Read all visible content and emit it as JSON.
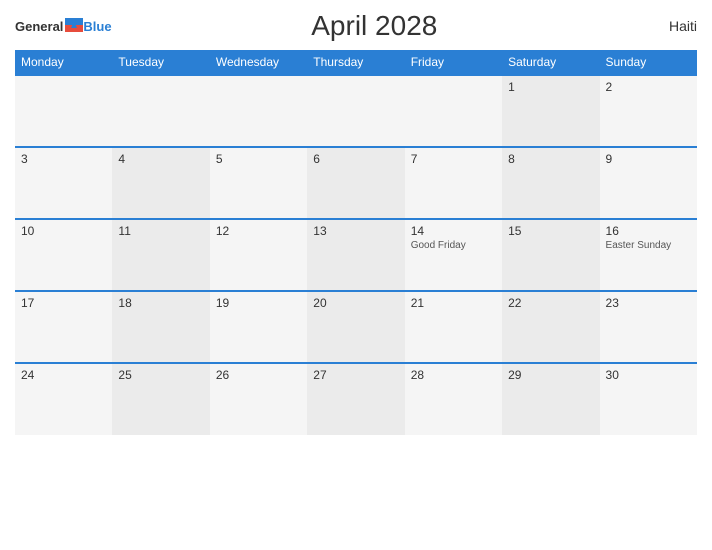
{
  "header": {
    "title": "April 2028",
    "country": "Haiti",
    "logo_general": "General",
    "logo_blue": "Blue"
  },
  "weekdays": [
    "Monday",
    "Tuesday",
    "Wednesday",
    "Thursday",
    "Friday",
    "Saturday",
    "Sunday"
  ],
  "weeks": [
    [
      {
        "day": "",
        "holiday": ""
      },
      {
        "day": "",
        "holiday": ""
      },
      {
        "day": "",
        "holiday": ""
      },
      {
        "day": "",
        "holiday": ""
      },
      {
        "day": "",
        "holiday": ""
      },
      {
        "day": "1",
        "holiday": ""
      },
      {
        "day": "2",
        "holiday": ""
      }
    ],
    [
      {
        "day": "3",
        "holiday": ""
      },
      {
        "day": "4",
        "holiday": ""
      },
      {
        "day": "5",
        "holiday": ""
      },
      {
        "day": "6",
        "holiday": ""
      },
      {
        "day": "7",
        "holiday": ""
      },
      {
        "day": "8",
        "holiday": ""
      },
      {
        "day": "9",
        "holiday": ""
      }
    ],
    [
      {
        "day": "10",
        "holiday": ""
      },
      {
        "day": "11",
        "holiday": ""
      },
      {
        "day": "12",
        "holiday": ""
      },
      {
        "day": "13",
        "holiday": ""
      },
      {
        "day": "14",
        "holiday": "Good Friday"
      },
      {
        "day": "15",
        "holiday": ""
      },
      {
        "day": "16",
        "holiday": "Easter Sunday"
      }
    ],
    [
      {
        "day": "17",
        "holiday": ""
      },
      {
        "day": "18",
        "holiday": ""
      },
      {
        "day": "19",
        "holiday": ""
      },
      {
        "day": "20",
        "holiday": ""
      },
      {
        "day": "21",
        "holiday": ""
      },
      {
        "day": "22",
        "holiday": ""
      },
      {
        "day": "23",
        "holiday": ""
      }
    ],
    [
      {
        "day": "24",
        "holiday": ""
      },
      {
        "day": "25",
        "holiday": ""
      },
      {
        "day": "26",
        "holiday": ""
      },
      {
        "day": "27",
        "holiday": ""
      },
      {
        "day": "28",
        "holiday": ""
      },
      {
        "day": "29",
        "holiday": ""
      },
      {
        "day": "30",
        "holiday": ""
      }
    ]
  ]
}
